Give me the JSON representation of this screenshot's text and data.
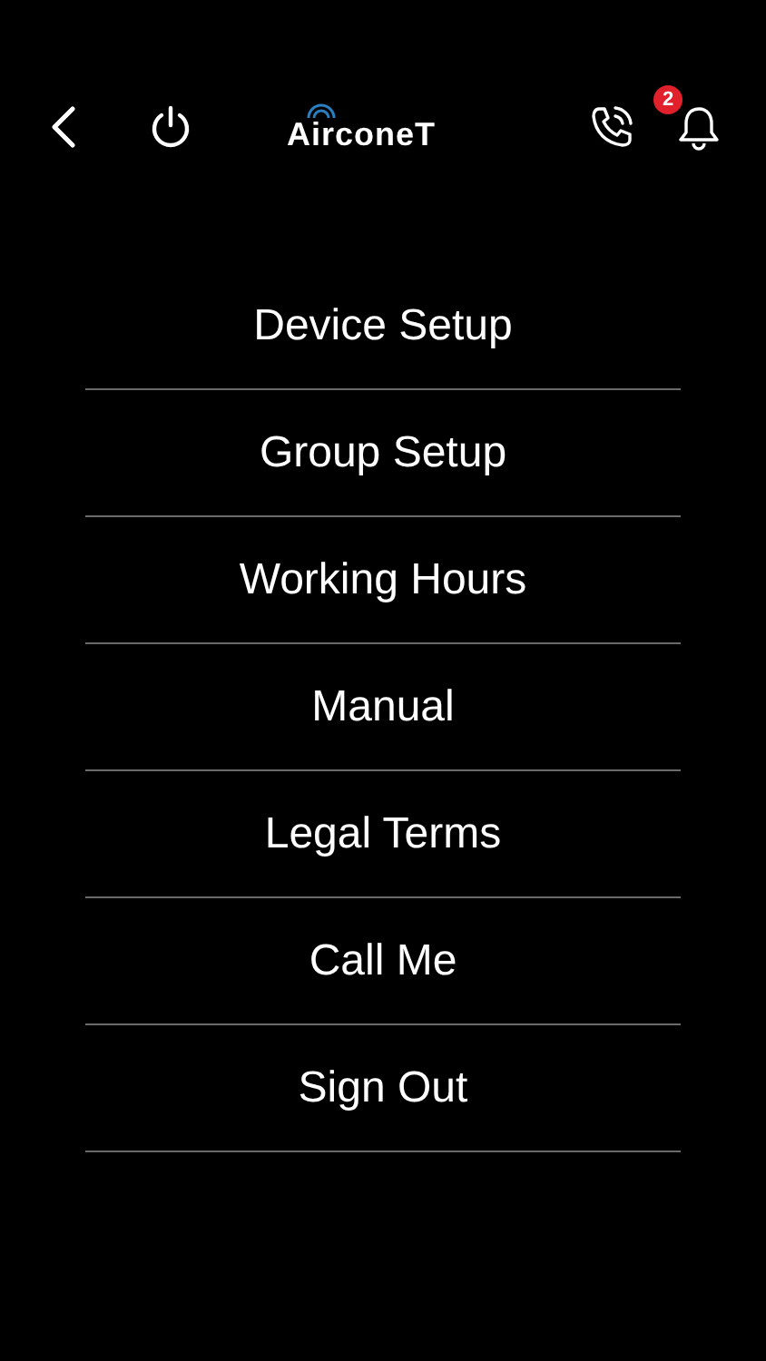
{
  "header": {
    "logo": "AirconeT",
    "notifications": {
      "badge": "2"
    }
  },
  "menu": [
    {
      "label": "Device Setup"
    },
    {
      "label": "Group Setup"
    },
    {
      "label": "Working Hours"
    },
    {
      "label": "Manual"
    },
    {
      "label": "Legal Terms"
    },
    {
      "label": "Call Me"
    },
    {
      "label": "Sign Out"
    }
  ]
}
